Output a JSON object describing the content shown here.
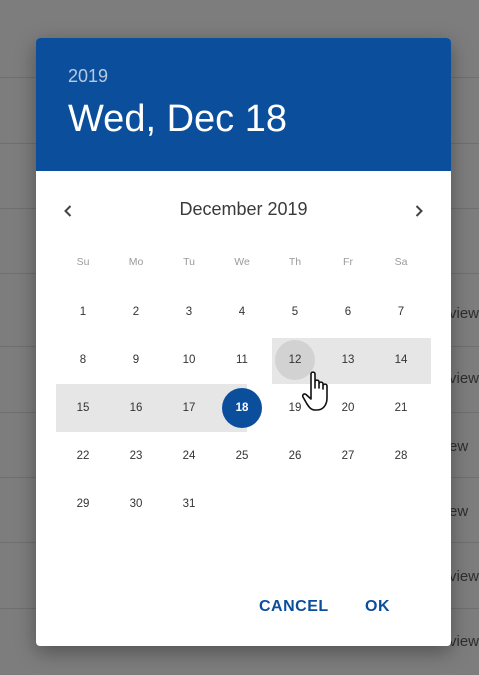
{
  "background": {
    "row_texts": [
      "view",
      "view",
      "ew",
      "ew",
      "view",
      "view"
    ]
  },
  "picker": {
    "year": "2019",
    "selected_date_label": "Wed, Dec 18",
    "month_label": "December 2019",
    "weekdays": [
      "Su",
      "Mo",
      "Tu",
      "We",
      "Th",
      "Fr",
      "Sa"
    ],
    "days": [
      "1",
      "2",
      "3",
      "4",
      "5",
      "6",
      "7",
      "8",
      "9",
      "10",
      "11",
      "12",
      "13",
      "14",
      "15",
      "16",
      "17",
      "18",
      "19",
      "20",
      "21",
      "22",
      "23",
      "24",
      "25",
      "26",
      "27",
      "28",
      "29",
      "30",
      "31"
    ],
    "selected_day": "18",
    "hovered_day": "12",
    "accent_color": "#0b4f9c"
  },
  "actions": {
    "cancel_label": "CANCEL",
    "ok_label": "OK"
  },
  "icons": {
    "prev": "chevron-left-icon",
    "next": "chevron-right-icon",
    "cursor": "hand-pointer-icon"
  }
}
